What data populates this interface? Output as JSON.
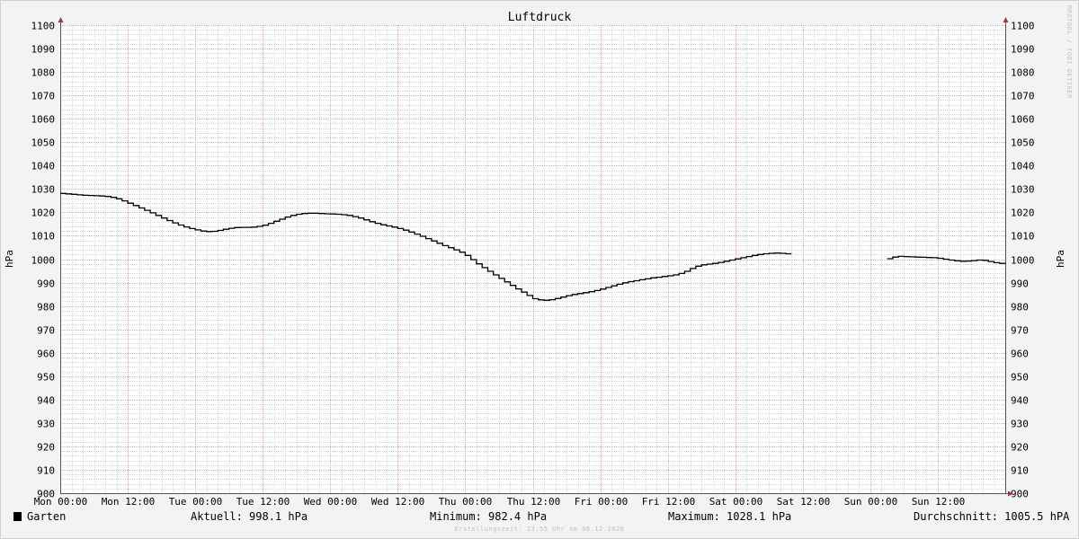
{
  "chart_data": {
    "type": "line",
    "title": "Luftdruck",
    "ylabel": "hPa",
    "ylabel_right": "hPa",
    "ylim": [
      900,
      1100
    ],
    "ytick_step": 10,
    "xlim_hours": [
      0,
      168
    ],
    "x_ticks": [
      {
        "label": "Mon 00:00",
        "hour": 0
      },
      {
        "label": "Mon 12:00",
        "hour": 12
      },
      {
        "label": "Tue 00:00",
        "hour": 24
      },
      {
        "label": "Tue 12:00",
        "hour": 36
      },
      {
        "label": "Wed 00:00",
        "hour": 48
      },
      {
        "label": "Wed 12:00",
        "hour": 60
      },
      {
        "label": "Thu 00:00",
        "hour": 72
      },
      {
        "label": "Thu 12:00",
        "hour": 84
      },
      {
        "label": "Fri 00:00",
        "hour": 96
      },
      {
        "label": "Fri 12:00",
        "hour": 108
      },
      {
        "label": "Sat 00:00",
        "hour": 120
      },
      {
        "label": "Sat 12:00",
        "hour": 132
      },
      {
        "label": "Sun 00:00",
        "hour": 144
      },
      {
        "label": "Sun 12:00",
        "hour": 156
      }
    ],
    "grid": true,
    "legend_position": "bottom-left",
    "series": [
      {
        "name": "Garten",
        "color": "#000000",
        "segments": [
          {
            "x": [
              0,
              1,
              2,
              3,
              4,
              5,
              6,
              7,
              8,
              9,
              10,
              11,
              12,
              13,
              14,
              15,
              16,
              17,
              18,
              19,
              20,
              21,
              22,
              23,
              24,
              25,
              26,
              27,
              28,
              29,
              30,
              31,
              32,
              33,
              34,
              35,
              36,
              37,
              38,
              39,
              40,
              41,
              42,
              43,
              44,
              45,
              46,
              47,
              48,
              49,
              50,
              51,
              52,
              53,
              54,
              55,
              56,
              57,
              58,
              59,
              60,
              61,
              62,
              63,
              64,
              65,
              66,
              67,
              68,
              69,
              70,
              71,
              72,
              73,
              74,
              75,
              76,
              77,
              78,
              79,
              80,
              81,
              82,
              83,
              84,
              85,
              86,
              87,
              88,
              89,
              90,
              91,
              92,
              93,
              94,
              95,
              96,
              97,
              98,
              99,
              100,
              101,
              102,
              103,
              104,
              105,
              106,
              107,
              108,
              109,
              110,
              111,
              112,
              113,
              114,
              115,
              116,
              117,
              118,
              119,
              120,
              121,
              122,
              123,
              124,
              125,
              126,
              127,
              128,
              129,
              130,
              131,
              132,
              133,
              134,
              135,
              136,
              137,
              138,
              139,
              140,
              141,
              142,
              143,
              144,
              145
            ],
            "y": [
              1028.1,
              1027.9,
              1027.7,
              1027.5,
              1027.3,
              1027.2,
              1027.1,
              1027.0,
              1026.8,
              1026.4,
              1025.8,
              1024.9,
              1023.9,
              1022.9,
              1021.9,
              1020.9,
              1019.8,
              1018.7,
              1017.6,
              1016.5,
              1015.5,
              1014.6,
              1013.8,
              1013.1,
              1012.5,
              1012.0,
              1011.8,
              1011.9,
              1012.3,
              1012.8,
              1013.2,
              1013.5,
              1013.6,
              1013.6,
              1013.7,
              1014.0,
              1014.5,
              1015.3,
              1016.2,
              1017.1,
              1018.0,
              1018.7,
              1019.2,
              1019.5,
              1019.6,
              1019.6,
              1019.5,
              1019.4,
              1019.3,
              1019.2,
              1019.0,
              1018.7,
              1018.2,
              1017.6,
              1016.8,
              1016.0,
              1015.3,
              1014.7,
              1014.2,
              1013.7,
              1013.1,
              1012.4,
              1011.6,
              1010.7,
              1009.8,
              1008.8,
              1007.8,
              1006.8,
              1005.8,
              1004.9,
              1004.0,
              1003.0,
              1001.6,
              999.8,
              998.0,
              996.4,
              994.8,
              993.3,
              991.8,
              990.3,
              988.8,
              987.3,
              985.9,
              984.5,
              983.1,
              982.6,
              982.4,
              982.7,
              983.2,
              983.8,
              984.4,
              984.9,
              985.3,
              985.7,
              986.1,
              986.6,
              987.2,
              987.9,
              988.6,
              989.3,
              989.9,
              990.4,
              990.8,
              991.2,
              991.6,
              992.0,
              992.3,
              992.6,
              992.9,
              993.3,
              993.9,
              994.8,
              996.0,
              997.0,
              997.6,
              997.9,
              998.2,
              998.6,
              999.1,
              999.6,
              1000.1,
              1000.6,
              1001.1,
              1001.6,
              1002.0,
              1002.3,
              1002.5,
              1002.6,
              1002.5,
              1002.3
            ]
          },
          {
            "x": [
              147,
              148,
              149,
              150,
              151,
              152,
              153,
              154,
              155,
              156,
              157,
              158,
              159,
              160,
              161,
              162,
              163,
              164,
              165,
              166,
              167,
              168
            ],
            "y": [
              1000.2,
              1000.9,
              1001.2,
              1001.1,
              1001.0,
              1000.9,
              1000.8,
              1000.7,
              1000.6,
              1000.4,
              1000.0,
              999.6,
              999.3,
              999.1,
              999.2,
              999.4,
              999.6,
              999.5,
              999.0,
              998.5,
              998.2,
              998.1
            ]
          }
        ]
      }
    ],
    "stats": {
      "series_label": "Garten",
      "current": "Aktuell: 998.1 hPa",
      "minimum": "Minimum: 982.4 hPa",
      "maximum": "Maximum: 1028.1 hPa",
      "average": "Durchschnitt: 1005.5 hPA"
    }
  },
  "footer": "Erstellungszeit: 23:55 Uhr am 06.12.2020",
  "watermark": "RRDTOOL / TOBI OETIKER"
}
